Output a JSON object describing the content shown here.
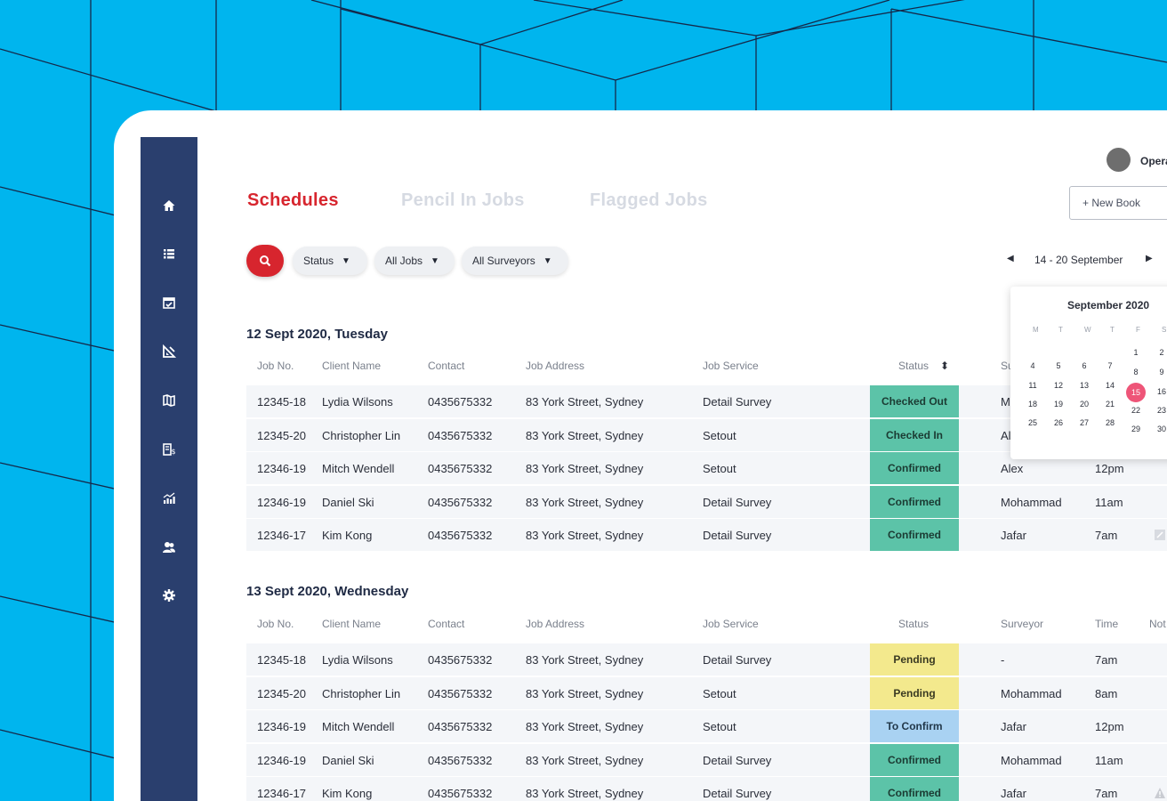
{
  "colors": {
    "background": "#00b5ee",
    "sidebar": "#2a3f6e",
    "accent": "#d7252e",
    "confirmed": "#5cc3a8",
    "pending": "#f3e98d",
    "to_confirm": "#a9d2f2",
    "selected_day": "#ee5578"
  },
  "sidebar": {
    "items": [
      {
        "icon": "home-icon"
      },
      {
        "icon": "list-icon"
      },
      {
        "icon": "calendar-check-icon"
      },
      {
        "icon": "ruler-triangle-icon"
      },
      {
        "icon": "map-icon"
      },
      {
        "icon": "invoice-icon"
      },
      {
        "icon": "analytics-icon"
      },
      {
        "icon": "users-icon"
      },
      {
        "icon": "gear-icon"
      }
    ]
  },
  "header": {
    "user_name": "Opera",
    "new_booking_label": "+ New Book"
  },
  "tabs": [
    {
      "label": "Schedules",
      "active": true
    },
    {
      "label": "Pencil In Jobs",
      "active": false
    },
    {
      "label": "Flagged Jobs",
      "active": false
    }
  ],
  "filters": {
    "status": "Status",
    "jobs": "All Jobs",
    "surveyors": "All Surveyors",
    "caret": "▼"
  },
  "week_nav": {
    "label": "14 - 20 September",
    "prev": "◀",
    "next": "▶"
  },
  "calendar": {
    "title": "September 2020",
    "weekdays": [
      "M",
      "T",
      "W",
      "T",
      "F",
      "S"
    ],
    "selected": "15",
    "days": [
      "1",
      "2",
      "4",
      "5",
      "6",
      "7",
      "8",
      "9",
      "11",
      "12",
      "13",
      "14",
      "15",
      "16",
      "18",
      "19",
      "20",
      "21",
      "22",
      "23",
      "25",
      "26",
      "27",
      "28",
      "29",
      "30"
    ]
  },
  "days": [
    {
      "title": "12 Sept 2020, Tuesday",
      "columns": {
        "job_no": "Job No.",
        "client": "Client Name",
        "contact": "Contact",
        "address": "Job Address",
        "service": "Job Service",
        "status": "Status",
        "status_sort": "⬍",
        "surveyor": "Su"
      },
      "rows": [
        {
          "job_no": "12345-18",
          "client": "Lydia Wilsons",
          "contact": "0435675332",
          "address": "83 York Street, Sydney",
          "service": "Detail Survey",
          "status": "Checked Out",
          "surveyor": "M",
          "time": ""
        },
        {
          "job_no": "12345-20",
          "client": "Christopher Lin",
          "contact": "0435675332",
          "address": "83 York Street, Sydney",
          "service": "Setout",
          "status": "Checked In",
          "surveyor": "Al",
          "time": ""
        },
        {
          "job_no": "12346-19",
          "client": "Mitch Wendell",
          "contact": "0435675332",
          "address": "83 York Street, Sydney",
          "service": "Setout",
          "status": "Confirmed",
          "surveyor": "Alex",
          "time": "12pm"
        },
        {
          "job_no": "12346-19",
          "client": "Daniel Ski",
          "contact": "0435675332",
          "address": "83 York Street, Sydney",
          "service": "Detail Survey",
          "status": "Confirmed",
          "surveyor": "Mohammad",
          "time": "11am"
        },
        {
          "job_no": "12346-17",
          "client": "Kim Kong",
          "contact": "0435675332",
          "address": "83 York Street, Sydney",
          "service": "Detail Survey",
          "status": "Confirmed",
          "surveyor": "Jafar",
          "time": "7am"
        }
      ]
    },
    {
      "title": "13 Sept 2020, Wednesday",
      "columns": {
        "job_no": "Job No.",
        "client": "Client Name",
        "contact": "Contact",
        "address": "Job Address",
        "service": "Job Service",
        "status": "Status",
        "surveyor": "Surveyor",
        "time": "Time",
        "notes": "Not"
      },
      "rows": [
        {
          "job_no": "12345-18",
          "client": "Lydia Wilsons",
          "contact": "0435675332",
          "address": "83 York Street, Sydney",
          "service": "Detail Survey",
          "status": "Pending",
          "surveyor": "-",
          "time": "7am"
        },
        {
          "job_no": "12345-20",
          "client": "Christopher Lin",
          "contact": "0435675332",
          "address": "83 York Street, Sydney",
          "service": "Setout",
          "status": "Pending",
          "surveyor": "Mohammad",
          "time": "8am"
        },
        {
          "job_no": "12346-19",
          "client": "Mitch Wendell",
          "contact": "0435675332",
          "address": "83 York Street, Sydney",
          "service": "Setout",
          "status": "To Confirm",
          "surveyor": "Jafar",
          "time": "12pm"
        },
        {
          "job_no": "12346-19",
          "client": "Daniel Ski",
          "contact": "0435675332",
          "address": "83 York Street, Sydney",
          "service": "Detail Survey",
          "status": "Confirmed",
          "surveyor": "Mohammad",
          "time": "11am"
        },
        {
          "job_no": "12346-17",
          "client": "Kim Kong",
          "contact": "0435675332",
          "address": "83 York Street, Sydney",
          "service": "Detail Survey",
          "status": "Confirmed",
          "surveyor": "Jafar",
          "time": "7am"
        }
      ]
    }
  ]
}
